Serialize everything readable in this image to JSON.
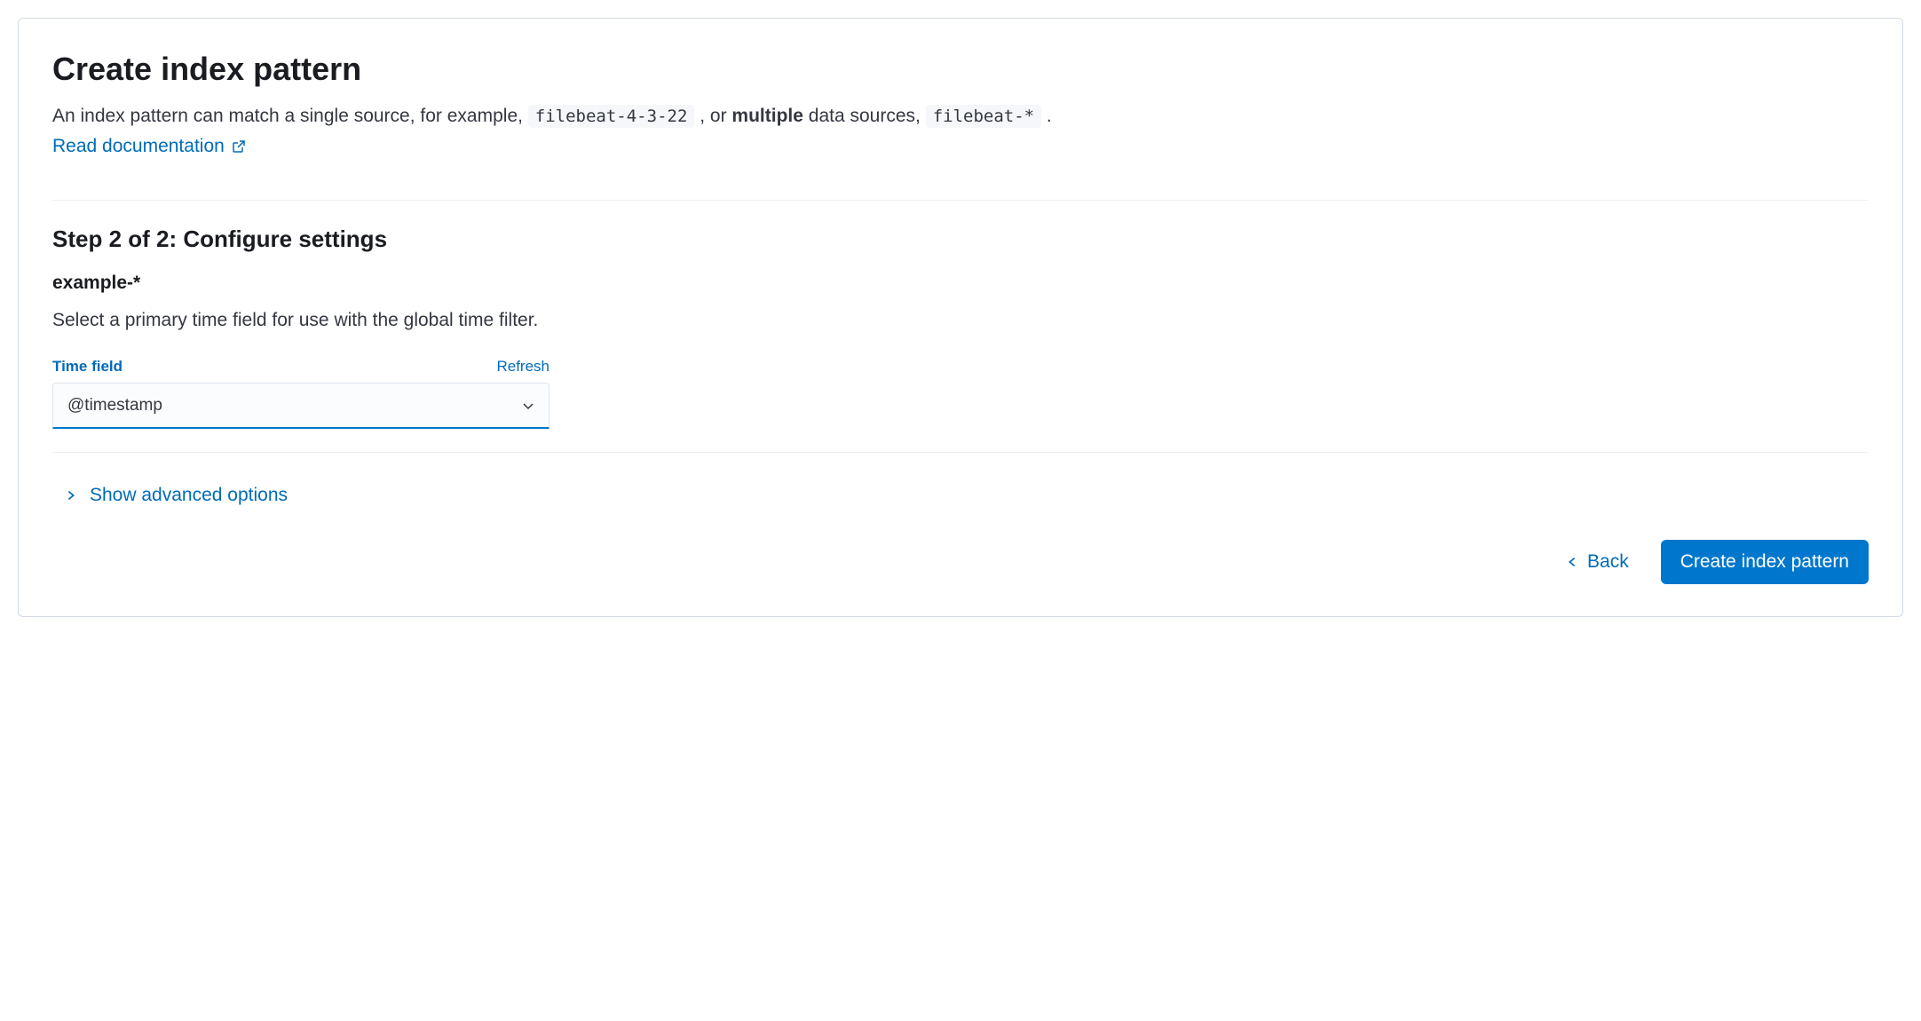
{
  "header": {
    "title": "Create index pattern",
    "description_prefix": "An index pattern can match a single source, for example, ",
    "code_single": "filebeat-4-3-22",
    "description_mid": " , or ",
    "description_bold": "multiple",
    "description_suffix": " data sources, ",
    "code_multi": "filebeat-*",
    "description_end": " .",
    "doc_link_label": "Read documentation"
  },
  "step": {
    "title": "Step 2 of 2: Configure settings",
    "pattern": "example-*",
    "help_text": "Select a primary time field for use with the global time filter."
  },
  "time_field": {
    "label": "Time field",
    "refresh_label": "Refresh",
    "selected": "@timestamp"
  },
  "advanced": {
    "toggle_label": "Show advanced options"
  },
  "footer": {
    "back_label": "Back",
    "submit_label": "Create index pattern"
  }
}
